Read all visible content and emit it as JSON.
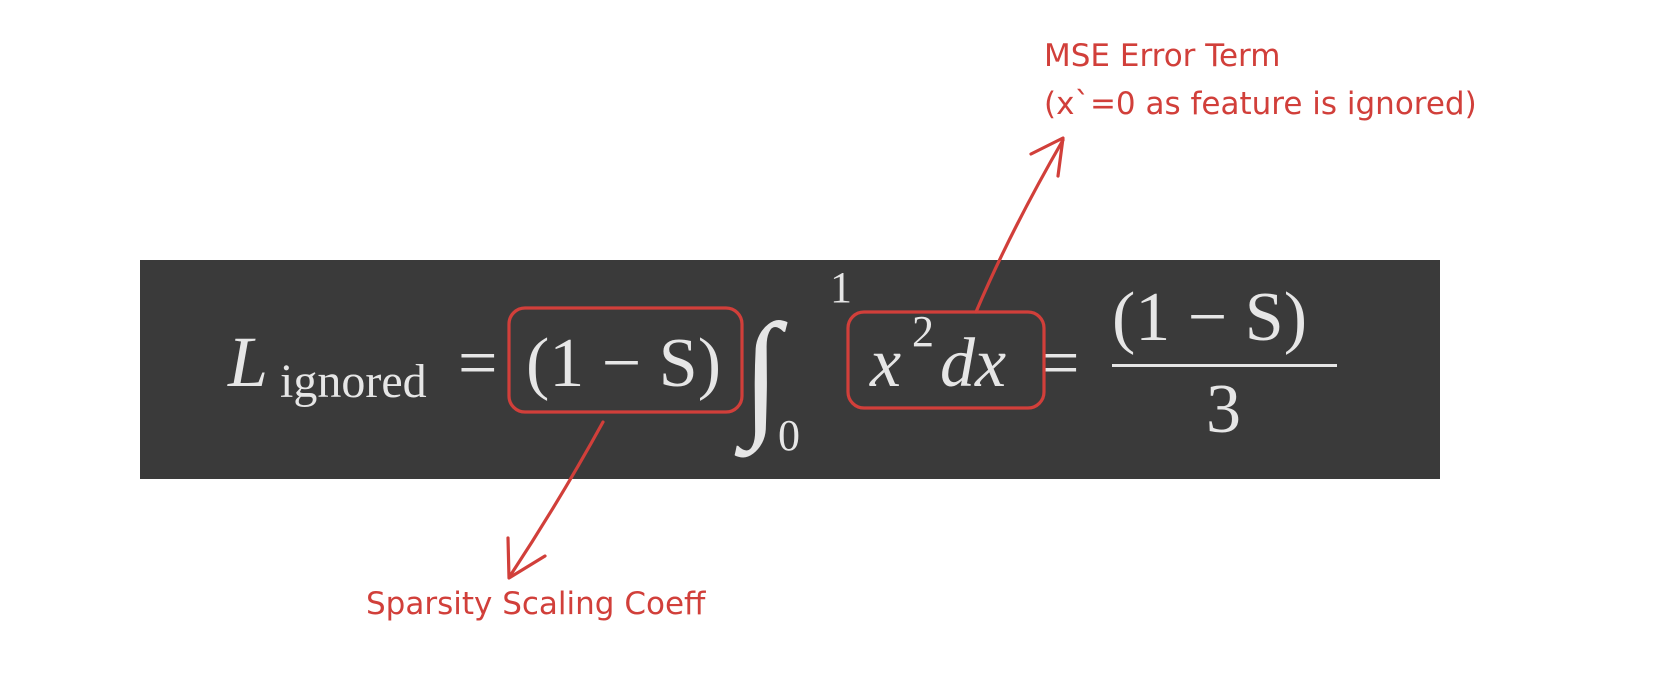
{
  "equation": {
    "lhs_symbol": "L",
    "lhs_subscript": "ignored",
    "equals": "=",
    "coeff": "(1 − S)",
    "integral_sign": "∫",
    "upper_limit": "1",
    "lower_limit": "0",
    "integrand_base": "x",
    "integrand_exponent": "2",
    "integrand_diff": "dx",
    "equals2": "=",
    "frac_numerator": "(1 − S)",
    "frac_denominator": "3"
  },
  "annotations": {
    "mse_title": "MSE Error Term",
    "mse_detail": "(x`=0 as feature is ignored)",
    "sparsity": "Sparsity Scaling Coeff"
  },
  "colors": {
    "panel_background": "#3a3a3a",
    "equation_text": "#e6e6e6",
    "annotation_red": "#d13f3a",
    "page_background": "#ffffff"
  }
}
